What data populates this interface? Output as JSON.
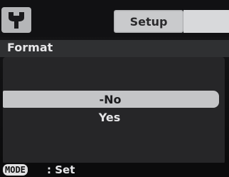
{
  "header": {
    "icon": "wrench-icon",
    "tab_label": "Setup"
  },
  "menu": {
    "title": "Format",
    "options": [
      {
        "label": "-No",
        "selected": true
      },
      {
        "label": "Yes",
        "selected": false
      }
    ]
  },
  "footer": {
    "button_label": "MODE",
    "action_label": ": Set"
  }
}
